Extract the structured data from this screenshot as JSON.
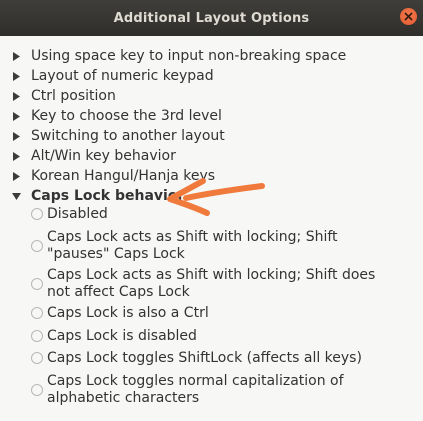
{
  "window": {
    "title": "Additional Layout Options"
  },
  "groups": [
    {
      "label": "Using space key to input non-breaking space"
    },
    {
      "label": "Layout of numeric keypad"
    },
    {
      "label": "Ctrl position"
    },
    {
      "label": "Key to choose the 3rd level"
    },
    {
      "label": "Switching to another layout"
    },
    {
      "label": "Alt/Win key behavior"
    },
    {
      "label": "Korean Hangul/Hanja keys"
    }
  ],
  "expanded_group": {
    "label": "Caps Lock behavior",
    "options": [
      {
        "label": "Disabled",
        "selected": false
      },
      {
        "label": "Caps Lock acts as Shift with locking; Shift \"pauses\" Caps Lock",
        "selected": false
      },
      {
        "label": "Caps Lock acts as Shift with locking; Shift does not affect Caps Lock",
        "selected": false
      },
      {
        "label": "Caps Lock is also a Ctrl",
        "selected": false
      },
      {
        "label": "Caps Lock is disabled",
        "selected": false
      },
      {
        "label": "Caps Lock toggles ShiftLock (affects all keys)",
        "selected": false
      },
      {
        "label": "Caps Lock toggles normal capitalization of alphabetic characters",
        "selected": false
      }
    ]
  },
  "colors": {
    "titlebar": "#3c3b37",
    "close_button": "#ec6a3c",
    "annotation_arrow": "#ef7a3c",
    "background": "#f7f7f6"
  },
  "icons": {
    "close": "close-icon",
    "collapsed": "triangle-right-icon",
    "expanded": "triangle-down-icon",
    "annotation": "hand-drawn-arrow-icon"
  }
}
